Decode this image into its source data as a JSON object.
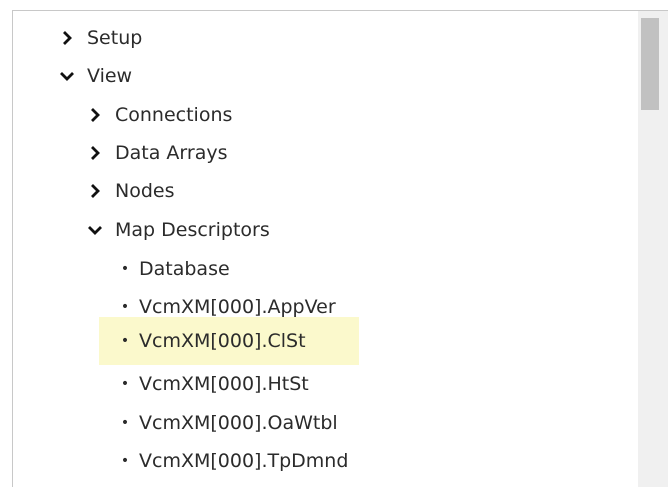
{
  "tree": {
    "items": [
      {
        "label": "Setup",
        "state": "collapsed",
        "level": 0
      },
      {
        "label": "View",
        "state": "expanded",
        "level": 0
      },
      {
        "label": "Connections",
        "state": "collapsed",
        "level": 1
      },
      {
        "label": "Data Arrays",
        "state": "collapsed",
        "level": 1
      },
      {
        "label": "Nodes",
        "state": "collapsed",
        "level": 1
      },
      {
        "label": "Map Descriptors",
        "state": "expanded",
        "level": 1
      },
      {
        "label": "Database",
        "state": "leaf",
        "level": 2
      },
      {
        "label": "VcmXM[000].AppVer",
        "state": "leaf",
        "level": 2
      },
      {
        "label": "VcmXM[000].ClSt",
        "state": "leaf",
        "level": 2,
        "highlighted": true
      },
      {
        "label": "VcmXM[000].HtSt",
        "state": "leaf",
        "level": 2
      },
      {
        "label": "VcmXM[000].OaWtbl",
        "state": "leaf",
        "level": 2
      },
      {
        "label": "VcmXM[000].TpDmnd",
        "state": "leaf",
        "level": 2
      }
    ],
    "bullet_glyph": "•"
  },
  "colors": {
    "highlight": "#fbf9cc",
    "text": "#2b2b2b",
    "scrollbar_track": "#f0f0f0",
    "scrollbar_thumb": "#c1c1c1",
    "border": "#c8c8c8"
  }
}
